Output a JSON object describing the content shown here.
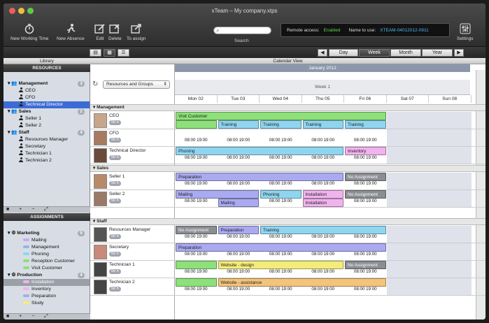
{
  "window": {
    "title": "xTeam – My company.xtps"
  },
  "toolbar": {
    "new_working_time": "New Working Time",
    "new_absence": "New Absence",
    "edit": "Edit",
    "delete": "Delete",
    "to_assign": "To assign",
    "search_label": "Search",
    "remote_access_label": "Remote access:",
    "remote_access_value": "Enabled",
    "name_to_use_label": "Name to use:",
    "name_to_use_value": "XTEAM-04012012-0911",
    "settings": "Settings"
  },
  "view_tabs": {
    "day": "Day",
    "week": "Week",
    "month": "Month",
    "year": "Year",
    "active": "Week"
  },
  "pane_titles": {
    "library": "Library",
    "calendar": "Calendar View"
  },
  "resources": {
    "header": "RESOURCES",
    "groups": [
      {
        "name": "Management",
        "count": "3",
        "members": [
          "CEO",
          "CFO",
          "Technical Director"
        ]
      },
      {
        "name": "Sales",
        "count": "2",
        "members": [
          "Seller 1",
          "Seller 2"
        ]
      },
      {
        "name": "Staff",
        "count": "4",
        "members": [
          "Resources Manager",
          "Secretary",
          "Technician 1",
          "Technician 2"
        ]
      }
    ],
    "selected": "Technical Director"
  },
  "assignments": {
    "header": "ASSIGNMENTS",
    "groups": [
      {
        "name": "Marketing",
        "count": "5",
        "items": [
          "Mailing",
          "Management",
          "Phoning",
          "Reception Customer",
          "Visit Customer"
        ]
      },
      {
        "name": "Production",
        "count": "4",
        "items": [
          "Installation",
          "Inventory",
          "Preparation",
          "Study"
        ]
      }
    ],
    "selected": "Installation"
  },
  "footer_glyphs": {
    "sb1": "■ + − ⤢",
    "sb2": "■ + − ⤢"
  },
  "calendar": {
    "filter_select": "Resources and Groups",
    "month": "January 2012",
    "week": "Week 1",
    "days": [
      "Mon 02",
      "Tue 03",
      "Wed 04",
      "Thu 05",
      "Fri 06",
      "Sat 07",
      "Sun 08"
    ],
    "time": "08:00 19:00",
    "hours": "50 h",
    "groups": [
      "Management",
      "Sales",
      "Staff"
    ]
  },
  "events": {
    "visit_customer": "Visit Customer",
    "training": "Training",
    "phoning": "Phoning",
    "inventory": "Inventory",
    "preparation": "Preparation",
    "no_assignment": "No Assignment",
    "mailing": "Mailing",
    "installation": "Installation",
    "website_design": "Website - design",
    "website_assistance": "Website - assistance"
  },
  "colors": {
    "green": "#8ee07a",
    "blue": "#8fd5f0",
    "lavender": "#a9aaf0",
    "pink": "#f0b3ee",
    "gray": "#8a8d92",
    "yellow": "#f4ec7a",
    "orange": "#f3c47a"
  }
}
